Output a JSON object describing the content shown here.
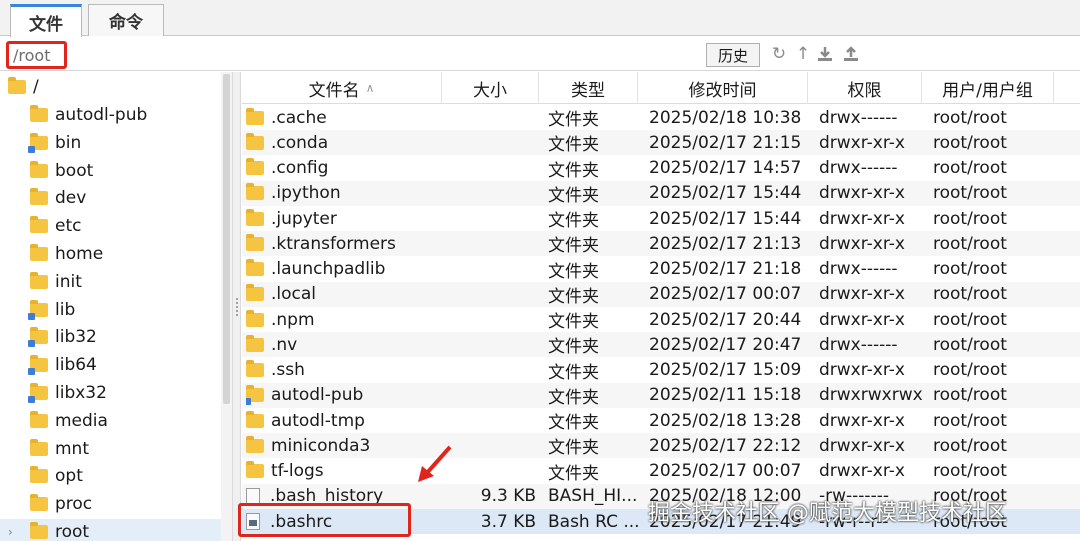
{
  "tabs": [
    {
      "label": "文件",
      "active": true
    },
    {
      "label": "命令",
      "active": false
    }
  ],
  "path": {
    "value": "/root"
  },
  "toolbar": {
    "history_label": "历史",
    "icons": [
      "refresh-icon",
      "up-icon",
      "download-icon",
      "upload-icon"
    ]
  },
  "tree": {
    "root_label": "/",
    "items": [
      {
        "label": "autodl-pub",
        "link": false
      },
      {
        "label": "bin",
        "link": true
      },
      {
        "label": "boot",
        "link": false
      },
      {
        "label": "dev",
        "link": false
      },
      {
        "label": "etc",
        "link": false
      },
      {
        "label": "home",
        "link": false
      },
      {
        "label": "init",
        "link": false
      },
      {
        "label": "lib",
        "link": true
      },
      {
        "label": "lib32",
        "link": true
      },
      {
        "label": "lib64",
        "link": true
      },
      {
        "label": "libx32",
        "link": true
      },
      {
        "label": "media",
        "link": false
      },
      {
        "label": "mnt",
        "link": false
      },
      {
        "label": "opt",
        "link": false
      },
      {
        "label": "proc",
        "link": false
      },
      {
        "label": "root",
        "link": false,
        "selected": true
      }
    ]
  },
  "columns": {
    "name": "文件名",
    "size": "大小",
    "type": "类型",
    "time": "修改时间",
    "perm": "权限",
    "owner": "用户/用户组"
  },
  "files": [
    {
      "name": ".cache",
      "size": "",
      "type": "文件夹",
      "time": "2025/02/18 10:38",
      "perm": "drwx------",
      "owner": "root/root",
      "icon": "folder"
    },
    {
      "name": ".conda",
      "size": "",
      "type": "文件夹",
      "time": "2025/02/17 21:15",
      "perm": "drwxr-xr-x",
      "owner": "root/root",
      "icon": "folder"
    },
    {
      "name": ".config",
      "size": "",
      "type": "文件夹",
      "time": "2025/02/17 14:57",
      "perm": "drwx------",
      "owner": "root/root",
      "icon": "folder"
    },
    {
      "name": ".ipython",
      "size": "",
      "type": "文件夹",
      "time": "2025/02/17 15:44",
      "perm": "drwxr-xr-x",
      "owner": "root/root",
      "icon": "folder"
    },
    {
      "name": ".jupyter",
      "size": "",
      "type": "文件夹",
      "time": "2025/02/17 15:44",
      "perm": "drwxr-xr-x",
      "owner": "root/root",
      "icon": "folder"
    },
    {
      "name": ".ktransformers",
      "size": "",
      "type": "文件夹",
      "time": "2025/02/17 21:13",
      "perm": "drwxr-xr-x",
      "owner": "root/root",
      "icon": "folder"
    },
    {
      "name": ".launchpadlib",
      "size": "",
      "type": "文件夹",
      "time": "2025/02/17 21:18",
      "perm": "drwx------",
      "owner": "root/root",
      "icon": "folder"
    },
    {
      "name": ".local",
      "size": "",
      "type": "文件夹",
      "time": "2025/02/17 00:07",
      "perm": "drwxr-xr-x",
      "owner": "root/root",
      "icon": "folder"
    },
    {
      "name": ".npm",
      "size": "",
      "type": "文件夹",
      "time": "2025/02/17 20:44",
      "perm": "drwxr-xr-x",
      "owner": "root/root",
      "icon": "folder"
    },
    {
      "name": ".nv",
      "size": "",
      "type": "文件夹",
      "time": "2025/02/17 20:47",
      "perm": "drwx------",
      "owner": "root/root",
      "icon": "folder"
    },
    {
      "name": ".ssh",
      "size": "",
      "type": "文件夹",
      "time": "2025/02/17 15:09",
      "perm": "drwxr-xr-x",
      "owner": "root/root",
      "icon": "folder"
    },
    {
      "name": "autodl-pub",
      "size": "",
      "type": "文件夹",
      "time": "2025/02/11 15:18",
      "perm": "drwxrwxrwx",
      "owner": "root/root",
      "icon": "folder-link"
    },
    {
      "name": "autodl-tmp",
      "size": "",
      "type": "文件夹",
      "time": "2025/02/18 13:28",
      "perm": "drwxr-xr-x",
      "owner": "root/root",
      "icon": "folder"
    },
    {
      "name": "miniconda3",
      "size": "",
      "type": "文件夹",
      "time": "2025/02/17 22:12",
      "perm": "drwxr-xr-x",
      "owner": "root/root",
      "icon": "folder"
    },
    {
      "name": "tf-logs",
      "size": "",
      "type": "文件夹",
      "time": "2025/02/17 00:07",
      "perm": "drwxr-xr-x",
      "owner": "root/root",
      "icon": "folder"
    },
    {
      "name": ".bash_history",
      "size": "9.3 KB",
      "type": "BASH_HI...",
      "time": "2025/02/18 12:00",
      "perm": "-rw-------",
      "owner": "root/root",
      "icon": "file"
    },
    {
      "name": ".bashrc",
      "size": "3.7 KB",
      "type": "Bash RC ...",
      "time": "2025/02/17 21:49",
      "perm": "-rw-r--r--",
      "owner": "root/root",
      "icon": "file-dark",
      "selected": true
    }
  ],
  "watermark": "掘金技术社区 @赋范大模型技术社区"
}
